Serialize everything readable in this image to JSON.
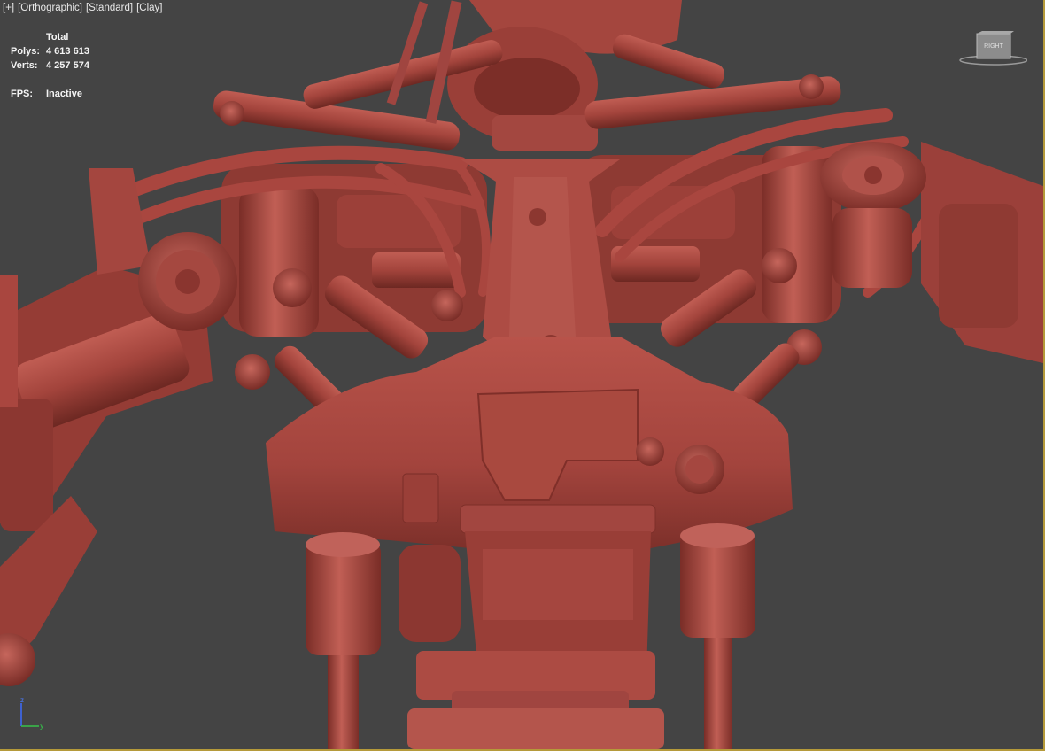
{
  "viewport": {
    "menu": [
      "[+]",
      "[Orthographic]",
      "[Standard]",
      "[Clay]"
    ],
    "stats": {
      "header": "Total",
      "polys_label": "Polys:",
      "polys_value": "4 613 613",
      "verts_label": "Verts:",
      "verts_value": "4 257 574",
      "fps_label": "FPS:",
      "fps_value": "Inactive"
    },
    "viewcube_label": "RIGHT",
    "axis": {
      "z": "z",
      "y": "y"
    },
    "colors": {
      "background": "#444444",
      "clay": "#a8463e",
      "clay_dark": "#6e2a25",
      "clay_light": "#c76a5f",
      "border": "#b59a3a"
    }
  }
}
